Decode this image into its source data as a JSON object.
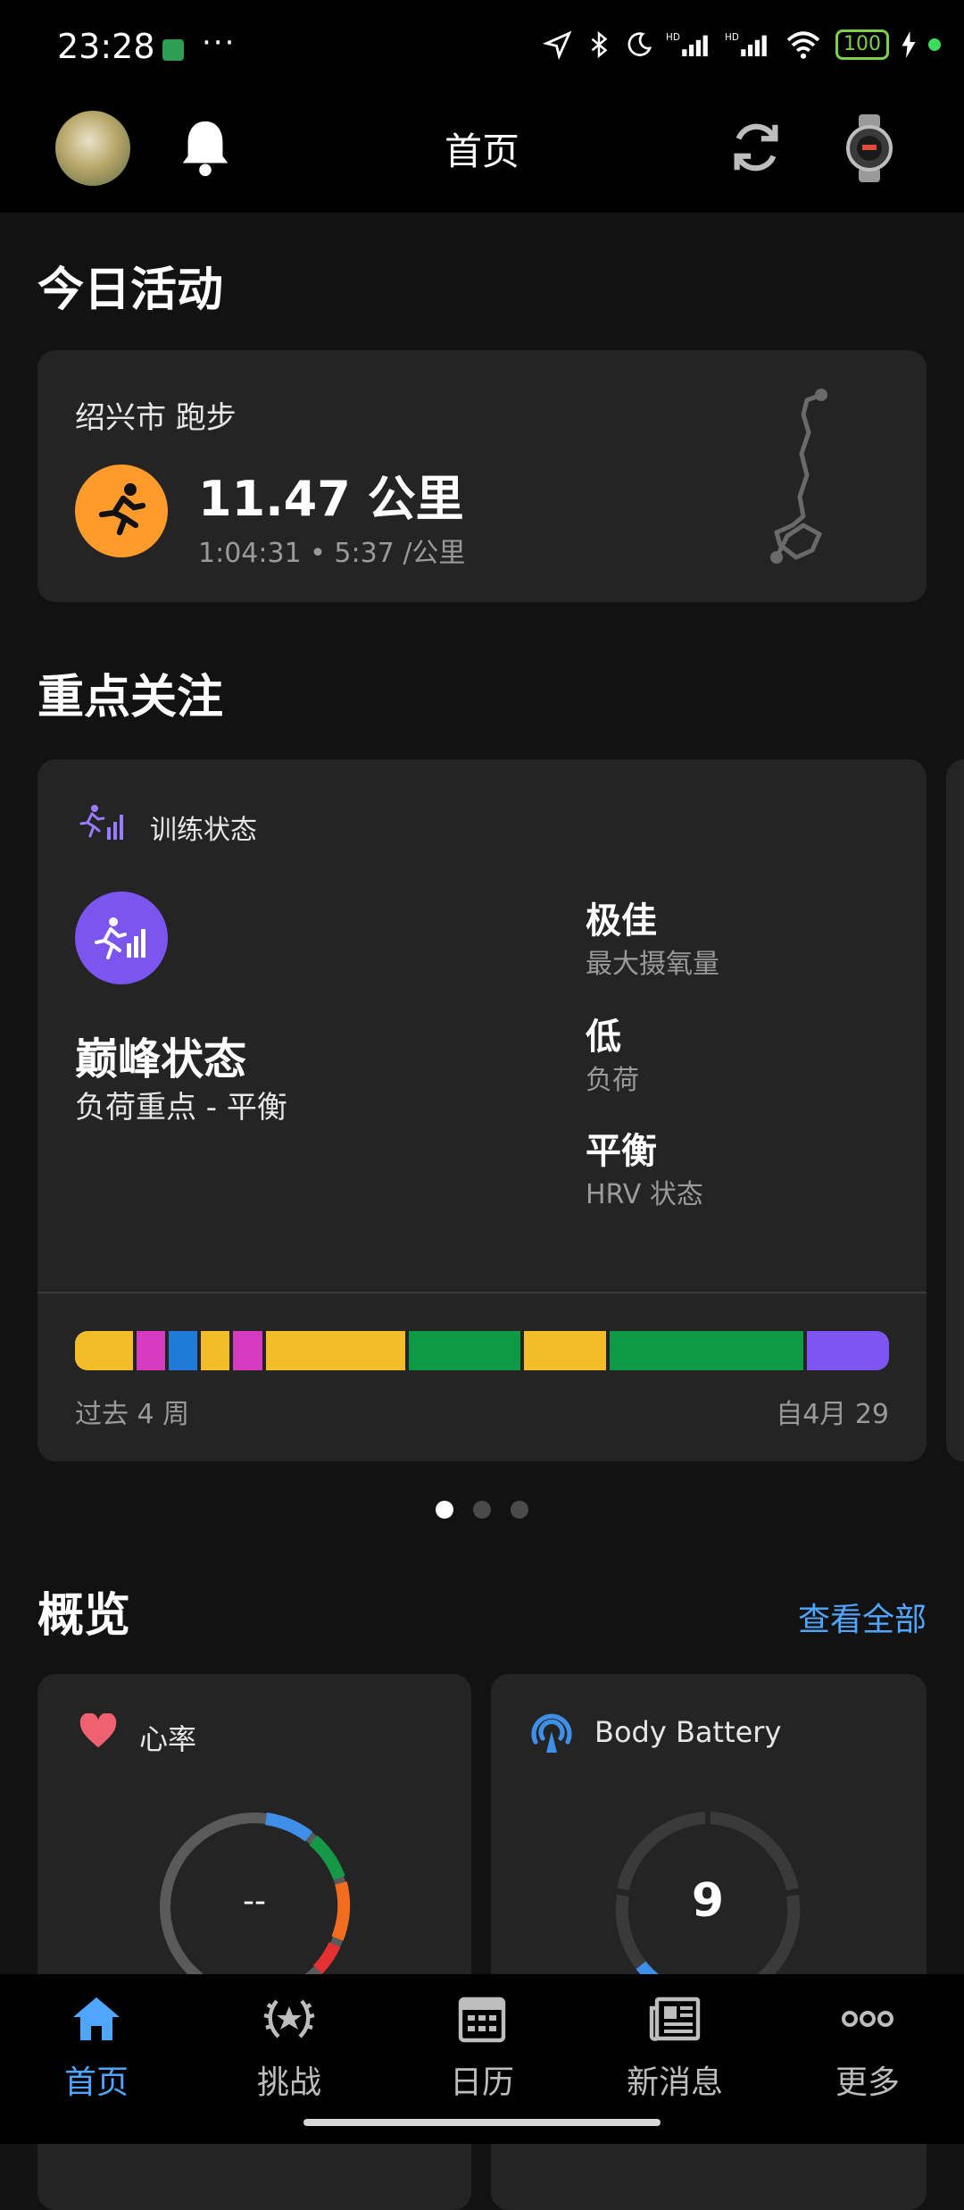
{
  "status_bar": {
    "time": "23:28",
    "more": "···",
    "battery": "100"
  },
  "header": {
    "title": "首页"
  },
  "today": {
    "section_title": "今日活动",
    "activity": {
      "location_type": "绍兴市 跑步",
      "distance": "11.47 公里",
      "details": "1:04:31 • 5:37 /公里",
      "icon": "running-icon",
      "accent": "#ff9b2b"
    }
  },
  "focus": {
    "section_title": "重点关注",
    "card": {
      "label": "训练状态",
      "status": "巅峰状态",
      "load_focus": "负荷重点 - 平衡",
      "metrics": [
        {
          "value": "极佳",
          "key": "最大摄氧量"
        },
        {
          "value": "低",
          "key": "负荷"
        },
        {
          "value": "平衡",
          "key": "HRV 状态"
        }
      ],
      "bar_segments": [
        {
          "color": "#f3bd29",
          "weight": 7
        },
        {
          "color": "#d63ac0",
          "weight": 3.5
        },
        {
          "color": "#1f7ad8",
          "weight": 3.5
        },
        {
          "color": "#f3bd29",
          "weight": 3.5
        },
        {
          "color": "#d63ac0",
          "weight": 3.5
        },
        {
          "color": "#f3bd29",
          "weight": 17
        },
        {
          "color": "#0e9a44",
          "weight": 13.5
        },
        {
          "color": "#f3bd29",
          "weight": 10
        },
        {
          "color": "#0e9a44",
          "weight": 23.5
        },
        {
          "color": "#7e55f0",
          "weight": 10
        }
      ],
      "past_label": "过去 4 周",
      "since_label": "自4月 29",
      "accent": "#7c54ee"
    },
    "pager": {
      "pages": 3,
      "active": 1
    }
  },
  "overview": {
    "section_title": "概览",
    "view_all": "查看全部",
    "heart_rate": {
      "label": "心率",
      "value": "--",
      "icon": "heart-icon"
    },
    "body_battery": {
      "label": "Body Battery",
      "value": "9",
      "icon": "body-battery-icon",
      "level": 0.09
    }
  },
  "nav": {
    "items": [
      {
        "label": "首页",
        "icon": "home-icon",
        "active": true
      },
      {
        "label": "挑战",
        "icon": "laurel-icon",
        "active": false
      },
      {
        "label": "日历",
        "icon": "calendar-icon",
        "active": false
      },
      {
        "label": "新消息",
        "icon": "news-icon",
        "active": false
      },
      {
        "label": "更多",
        "icon": "more-icon",
        "active": false
      }
    ]
  },
  "colors": {
    "background": "#121212",
    "card": "#242424",
    "link": "#4fa6ff"
  }
}
